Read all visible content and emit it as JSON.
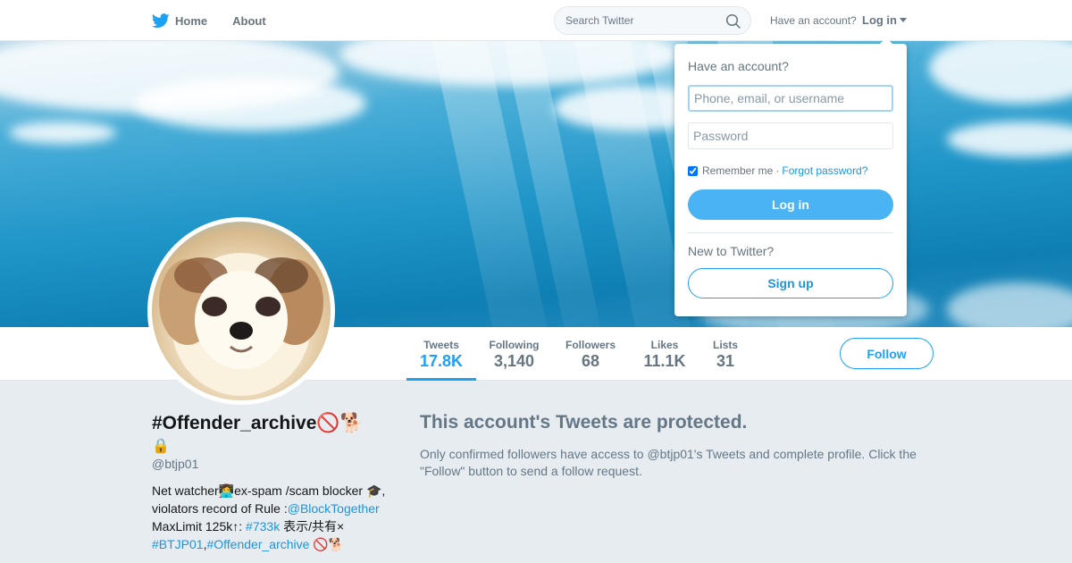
{
  "nav": {
    "home_label": "Home",
    "about_label": "About",
    "search_placeholder": "Search Twitter",
    "have_account_text": "Have an account?",
    "login_label": "Log in",
    "brand_color": "#1da1f2"
  },
  "login_dropdown": {
    "title": "Have an account?",
    "username_placeholder": "Phone, email, or username",
    "password_placeholder": "Password",
    "remember_label": "Remember me",
    "separator": "·",
    "forgot_label": "Forgot password?",
    "login_button": "Log in",
    "new_text": "New to Twitter?",
    "signup_button": "Sign up"
  },
  "stats": [
    {
      "label": "Tweets",
      "value": "17.8K"
    },
    {
      "label": "Following",
      "value": "3,140"
    },
    {
      "label": "Followers",
      "value": "68"
    },
    {
      "label": "Likes",
      "value": "11.1K"
    },
    {
      "label": "Lists",
      "value": "31"
    }
  ],
  "follow_button": "Follow",
  "profile": {
    "fullname": "#Offender_archive🚫🐕",
    "lock_icon": "🔒",
    "screen_name": "@btjp01",
    "bio": {
      "t1": "Net watcher👩‍💻ex-spam /scam blocker 🎓, violators record of Rule :",
      "l1": "@BlockTogether",
      "t2": " MaxLimit 125k↑: ",
      "l2": "#733k",
      "t3": " 表示/共有× ",
      "l3": "#BTJP01",
      "t4": ",",
      "l4": "#Offender_archive",
      "t5": " 🚫🐕"
    }
  },
  "protected": {
    "heading": "This account's Tweets are protected.",
    "body": "Only confirmed followers have access to @btjp01's Tweets and complete profile. Click the \"Follow\" button to send a follow request."
  }
}
